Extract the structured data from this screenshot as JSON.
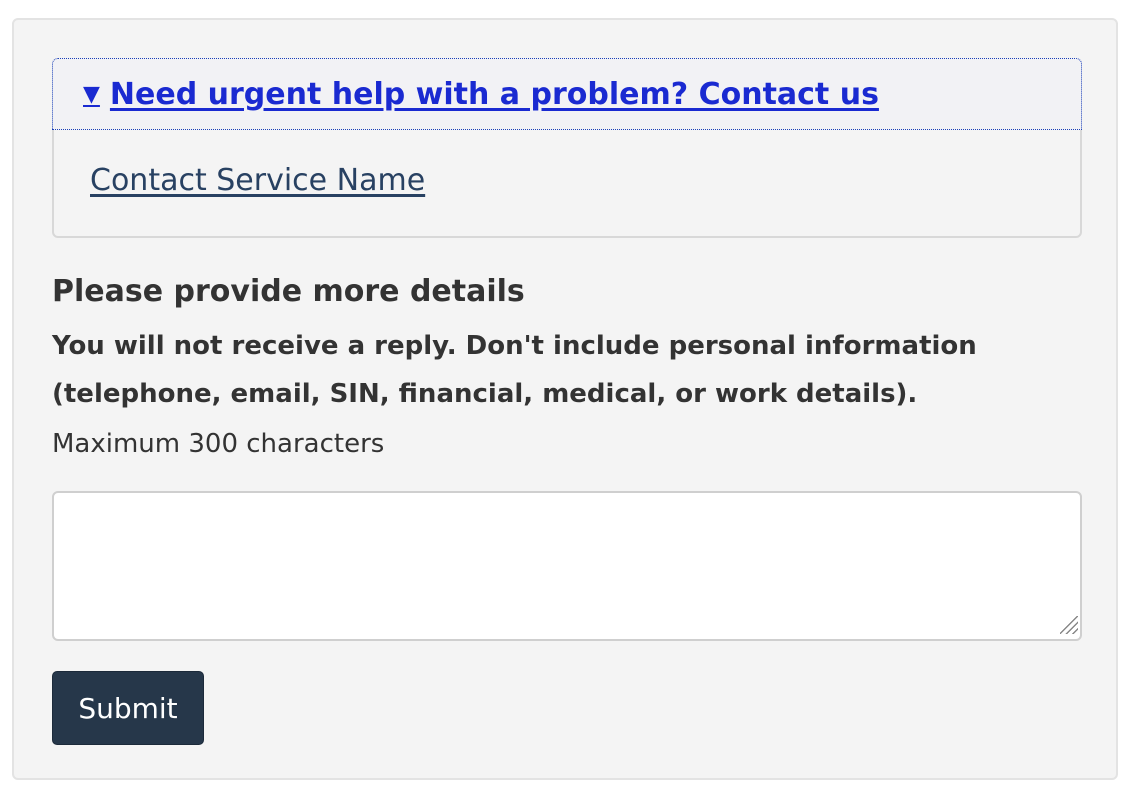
{
  "details": {
    "summary_caret": "▼",
    "summary_text": "Need urgent help with a problem? Contact us",
    "contact_link": "Contact Service Name"
  },
  "form": {
    "heading": "Please provide more details",
    "warning": "You will not receive a reply. Don't include personal information (telephone, email, SIN, financial, medical, or work details).",
    "hint": "Maximum 300 characters",
    "textarea_value": "",
    "submit_label": "Submit"
  },
  "colors": {
    "panel_bg": "#f4f4f4",
    "link_blue": "#1a2ad1",
    "contact_link": "#284162",
    "button_bg": "#26374a"
  }
}
